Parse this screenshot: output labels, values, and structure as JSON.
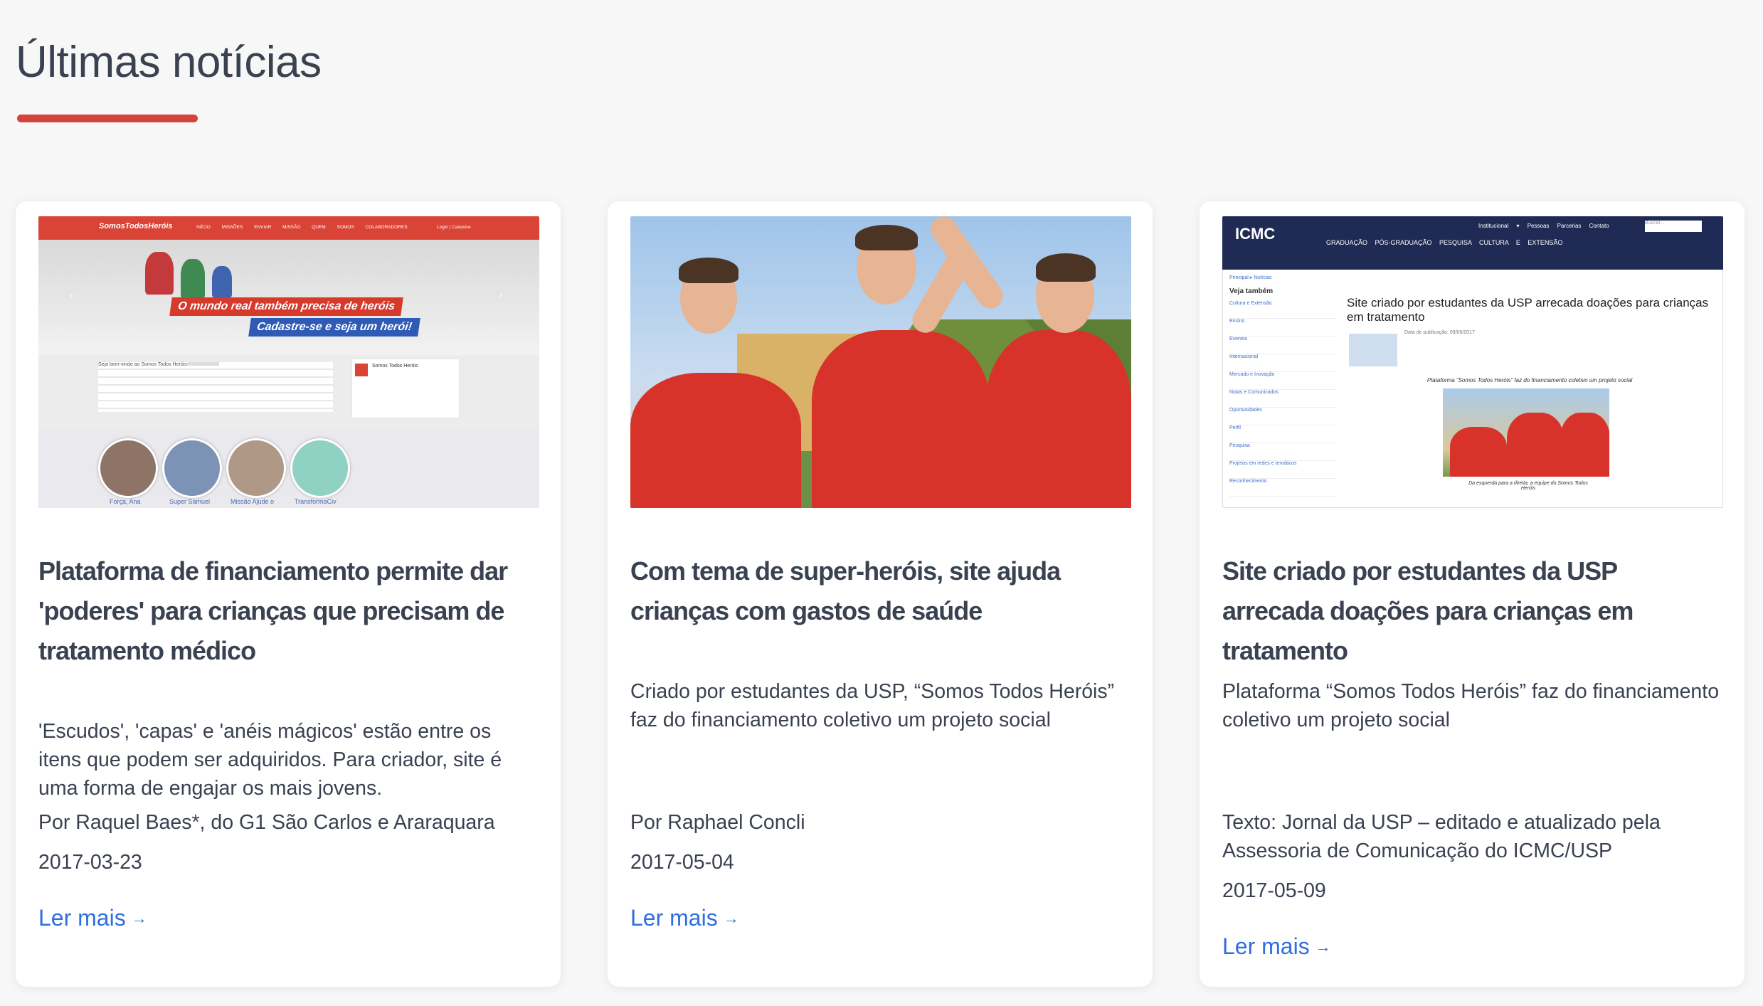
{
  "section": {
    "title": "Últimas notícias"
  },
  "colors": {
    "accent": "#d2443d",
    "link": "#2f6ee0",
    "text": "#3a4150",
    "background": "#f7f7f8"
  },
  "cards": [
    {
      "image_alt": "Screenshot of the Somos Todos Heróis website",
      "image_text": {
        "logo": "SomosTodosHeróis",
        "menu": "INÍCIO MISSÕES ENVIAR MISSÃO QUEM SOMOS COLABORADORES",
        "login": "Login | Cadastre",
        "banner_a": "O mundo real também precisa de heróis",
        "banner_b": "Cadastre-se e seja um herói!",
        "welcome": "Seja bem-vindo ao Somos Todos Heróis",
        "box_title": "Somos Todos Heróis",
        "avatar_labels": [
          "Força, Ana",
          "Super Samuel",
          "Missão Ajude o",
          "TransformaCiv"
        ]
      },
      "title": "Plataforma de financiamento permite dar 'poderes' para crianças que precisam de tratamento médico",
      "description": "'Escudos', 'capas' e 'anéis mágicos' estão entre os itens que podem ser adquiridos. Para criador, site é uma forma de engajar os mais jovens.",
      "author": "Por Raquel Baes*, do G1 São Carlos e Araraquara",
      "date": "2017-03-23",
      "link_label": "Ler mais",
      "link_arrow": "→"
    },
    {
      "image_alt": "Three students in red Somos Todos Heróis shirts cheering outdoors",
      "title": "Com tema de super-heróis, site ajuda crianças com gastos de saúde",
      "description": "Criado por estudantes da USP, “Somos Todos Heróis” faz do financiamento coletivo um projeto social",
      "author": "Por Raphael Concli",
      "date": "2017-05-04",
      "link_label": "Ler mais",
      "link_arrow": "→"
    },
    {
      "image_alt": "Screenshot of ICMC USP news page",
      "image_text": {
        "logo": "ICMC",
        "menu": "GRADUAÇÃO PÓS-GRADUAÇÃO PESQUISA CULTURA E EXTENSÃO",
        "top_menu": "Institucional ▾ Pessoas Parcerias Contato",
        "search": "Buscar...",
        "crumb": "Principal ▸ Notícias",
        "side_heading": "Veja também",
        "side_items": [
          "Cultura e Extensão",
          "Ensino",
          "Eventos",
          "Internacional",
          "Mercado e Inovação",
          "Notas e Comunicados",
          "Oportunidades",
          "Perfil",
          "Pesquisa",
          "Projetos em redes e temáticos",
          "Reconhecimento"
        ],
        "headline": "Site criado por estudantes da USP arrecada doações para crianças em tratamento",
        "pub_date": "Data de publicação: 09/06/2017",
        "caption": "Plataforma “Somos Todos Heróis” faz do financiamento coletivo um projeto social",
        "photo_caption": "Da esquerda para a direita, a equipe do Somos Todos Heróis"
      },
      "title": "Site criado por estudantes da USP arrecada doações para crianças em tratamento",
      "description": "Plataforma “Somos Todos Heróis” faz do financiamento coletivo um projeto social",
      "author": "Texto: Jornal da USP – editado e atualizado pela Assessoria de Comunicação do ICMC/USP",
      "date": "2017-05-09",
      "link_label": "Ler mais",
      "link_arrow": "→"
    }
  ]
}
